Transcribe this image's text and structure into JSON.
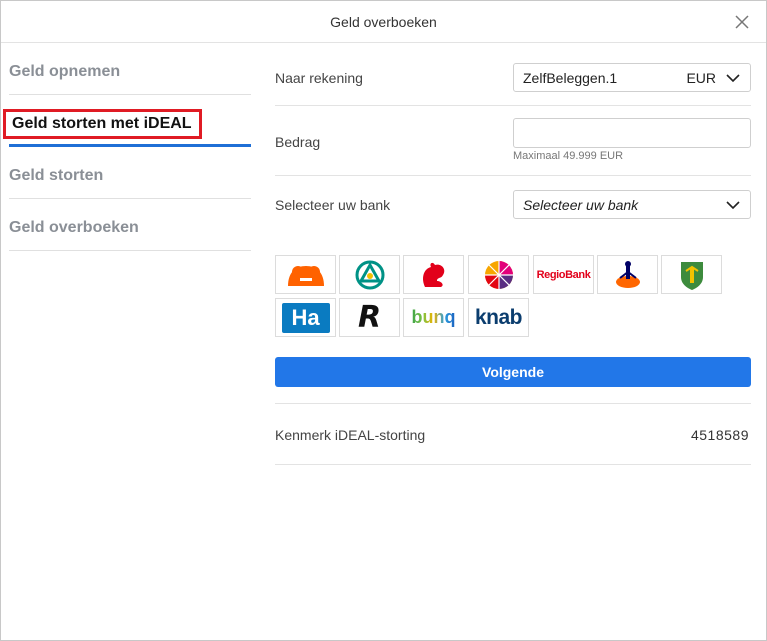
{
  "header": {
    "title": "Geld overboeken"
  },
  "sidebar": {
    "items": [
      {
        "label": "Geld opnemen"
      },
      {
        "label": "Geld storten met iDEAL"
      },
      {
        "label": "Geld storten"
      },
      {
        "label": "Geld overboeken"
      }
    ],
    "active_index": 1
  },
  "form": {
    "account": {
      "label": "Naar rekening",
      "value": "ZelfBeleggen.1",
      "currency": "EUR"
    },
    "amount": {
      "label": "Bedrag",
      "value": "",
      "hint": "Maximaal 49.999 EUR"
    },
    "bank": {
      "label": "Selecteer uw bank",
      "placeholder": "Selecteer uw bank"
    }
  },
  "banks": [
    {
      "name": "ing-logo-icon"
    },
    {
      "name": "abn-amro-logo-icon"
    },
    {
      "name": "asn-squirrel-logo-icon"
    },
    {
      "name": "sns-logo-icon"
    },
    {
      "name": "regiobank-logo",
      "text": "RegioBank"
    },
    {
      "name": "rabobank-logo-icon"
    },
    {
      "name": "triodos-logo-icon"
    },
    {
      "name": "handelsbanken-logo",
      "text": "Ha"
    },
    {
      "name": "revolut-logo",
      "text": "R"
    },
    {
      "name": "bunq-logo",
      "text": "bunq"
    },
    {
      "name": "knab-logo",
      "text": "knab"
    }
  ],
  "actions": {
    "next_label": "Volgende"
  },
  "reference": {
    "label": "Kenmerk iDEAL-storting",
    "value": "4518589"
  },
  "colors": {
    "primary": "#2277e8",
    "highlight_border": "#e01b24",
    "active_bar": "#1f6fd6"
  }
}
